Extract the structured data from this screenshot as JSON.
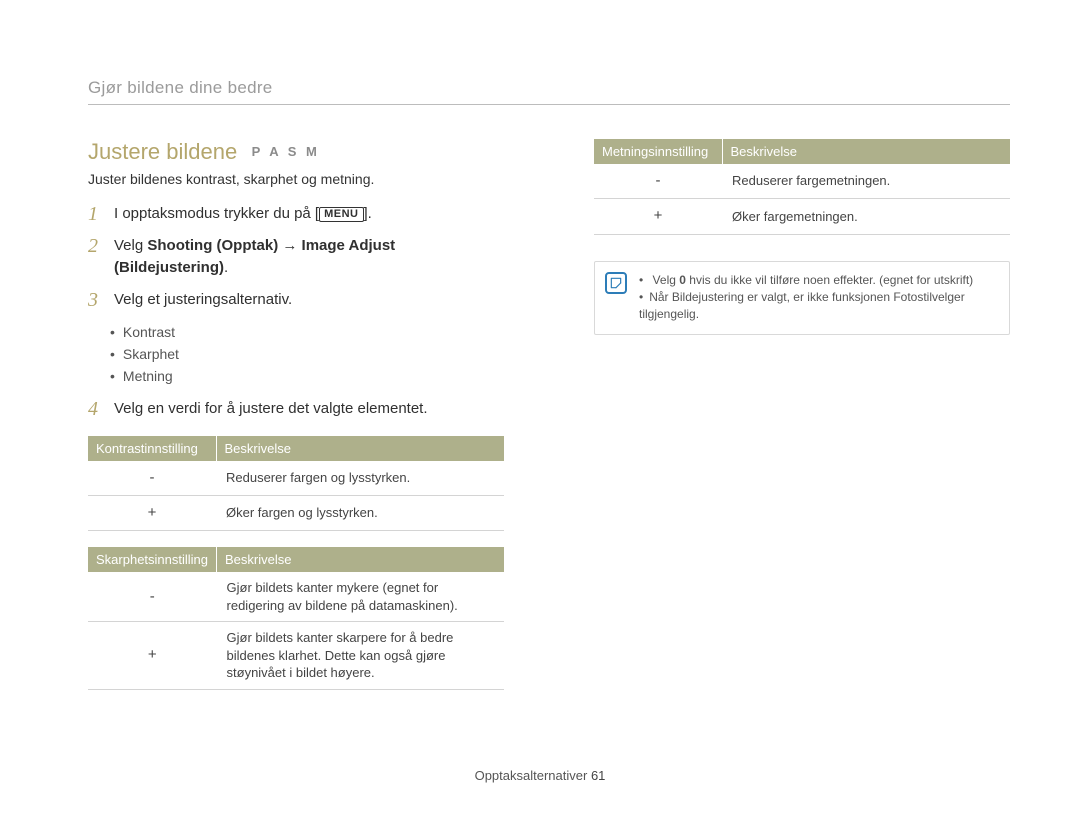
{
  "breadcrumb": "Gjør bildene dine bedre",
  "section": {
    "title": "Justere bildene",
    "modes": "P A S M",
    "subtitle": "Juster bildenes kontrast, skarphet og metning."
  },
  "steps": {
    "s1": {
      "num": "1",
      "pre": "I opptaksmodus trykker du på [",
      "btn": "MENU",
      "post": "]."
    },
    "s2": {
      "num": "2",
      "pre": "Velg ",
      "bold1": "Shooting (Opptak)",
      "arrow": " → ",
      "bold2": "Image Adjust (Bildejustering)",
      "post": "."
    },
    "s3": {
      "num": "3",
      "text": "Velg et justeringsalternativ."
    },
    "s3_bullets": [
      "Kontrast",
      "Skarphet",
      "Metning"
    ],
    "s4": {
      "num": "4",
      "text": "Velg en verdi for å justere det valgte elementet."
    }
  },
  "tables": {
    "contrast": {
      "h1": "Kontrastinnstilling",
      "h2": "Beskrivelse",
      "rows": [
        {
          "k": "-",
          "v": "Reduserer fargen og lysstyrken."
        },
        {
          "k": "+",
          "v": "Øker fargen og lysstyrken."
        }
      ]
    },
    "sharpness": {
      "h1": "Skarphetsinnstilling",
      "h2": "Beskrivelse",
      "rows": [
        {
          "k": "-",
          "v": "Gjør bildets kanter mykere (egnet for redigering av bildene på datamaskinen)."
        },
        {
          "k": "+",
          "v": "Gjør bildets kanter skarpere for å bedre bildenes klarhet. Dette kan også gjøre støynivået i bildet høyere."
        }
      ]
    },
    "saturation": {
      "h1": "Metningsinnstilling",
      "h2": "Beskrivelse",
      "rows": [
        {
          "k": "-",
          "v": "Reduserer fargemetningen."
        },
        {
          "k": "+",
          "v": "Øker fargemetningen."
        }
      ]
    }
  },
  "notes": {
    "n1_pre": "Velg ",
    "n1_bold": "0",
    "n1_post": " hvis du ikke vil tilføre noen effekter. (egnet for utskrift)",
    "n2": "Når Bildejustering er valgt, er ikke funksjonen Fotostilvelger tilgjengelig."
  },
  "footer": {
    "label": "Opptaksalternativer",
    "page": "61"
  }
}
